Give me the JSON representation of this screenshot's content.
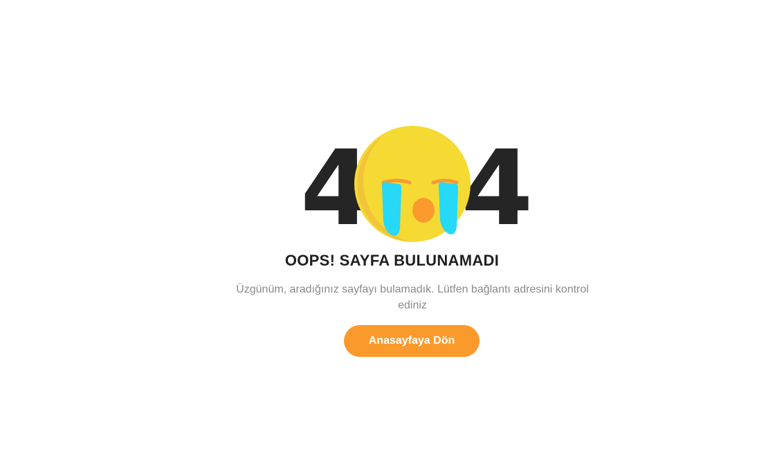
{
  "error": {
    "code_left": "4",
    "code_right": "4",
    "title": "OOPS! SAYFA BULUNAMADI",
    "message": "Üzgünüm, aradığınız sayfayı bulamadık. Lütfen bağlantı adresini kontrol ediniz",
    "button_label": "Anasayfaya Dön",
    "emoji_icon": "crying-face-icon"
  },
  "colors": {
    "accent": "#fb9a2c",
    "text_dark": "#252525",
    "text_muted": "#8a8a8a",
    "face_yellow": "#f5da33",
    "tear_blue": "#27d8f7",
    "mouth_orange": "#fb9a2c"
  }
}
